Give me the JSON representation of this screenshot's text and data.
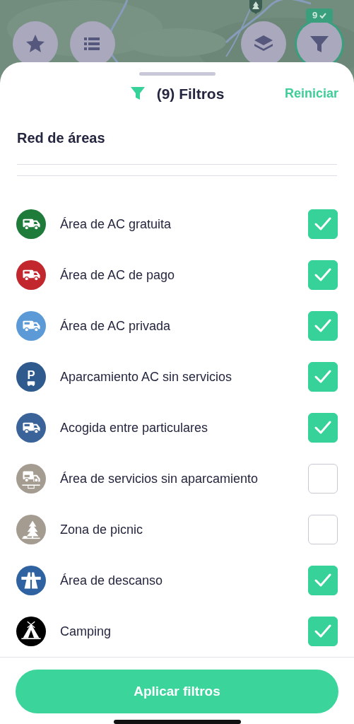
{
  "map": {
    "buttons": [
      {
        "kind": "star"
      },
      {
        "kind": "list"
      },
      {
        "kind": "layers"
      },
      {
        "kind": "filter",
        "badge": "9"
      }
    ]
  },
  "sheet": {
    "title": "(9) Filtros",
    "reset": "Reiniciar",
    "section": "Red de áreas",
    "items": [
      {
        "label": "Área de AC gratuita",
        "kind": "motorhome",
        "color": "#1e7b3a",
        "checked": true
      },
      {
        "label": "Área de AC de pago",
        "kind": "motorhome",
        "color": "#c1272d",
        "checked": true
      },
      {
        "label": "Área de AC privada",
        "kind": "motorhome",
        "color": "#5b9ad6",
        "checked": true
      },
      {
        "label": "Aparcamiento AC sin servicios",
        "kind": "parking",
        "icon_text": "P",
        "color": "#2f5a8e",
        "checked": true
      },
      {
        "label": "Acogida entre particulares",
        "kind": "motorhome",
        "color": "#3a6399",
        "checked": true
      },
      {
        "label": "Área de servicios sin aparcamiento",
        "kind": "service",
        "color": "#a59c91",
        "checked": false
      },
      {
        "label": "Zona de picnic",
        "kind": "tree",
        "color": "#a59c91",
        "checked": false
      },
      {
        "label": "Área de descanso",
        "kind": "highway",
        "color": "#2f62a0",
        "checked": true
      },
      {
        "label": "Camping",
        "kind": "tent",
        "color": "#000000",
        "checked": true
      }
    ],
    "apply": "Aplicar filtros"
  }
}
